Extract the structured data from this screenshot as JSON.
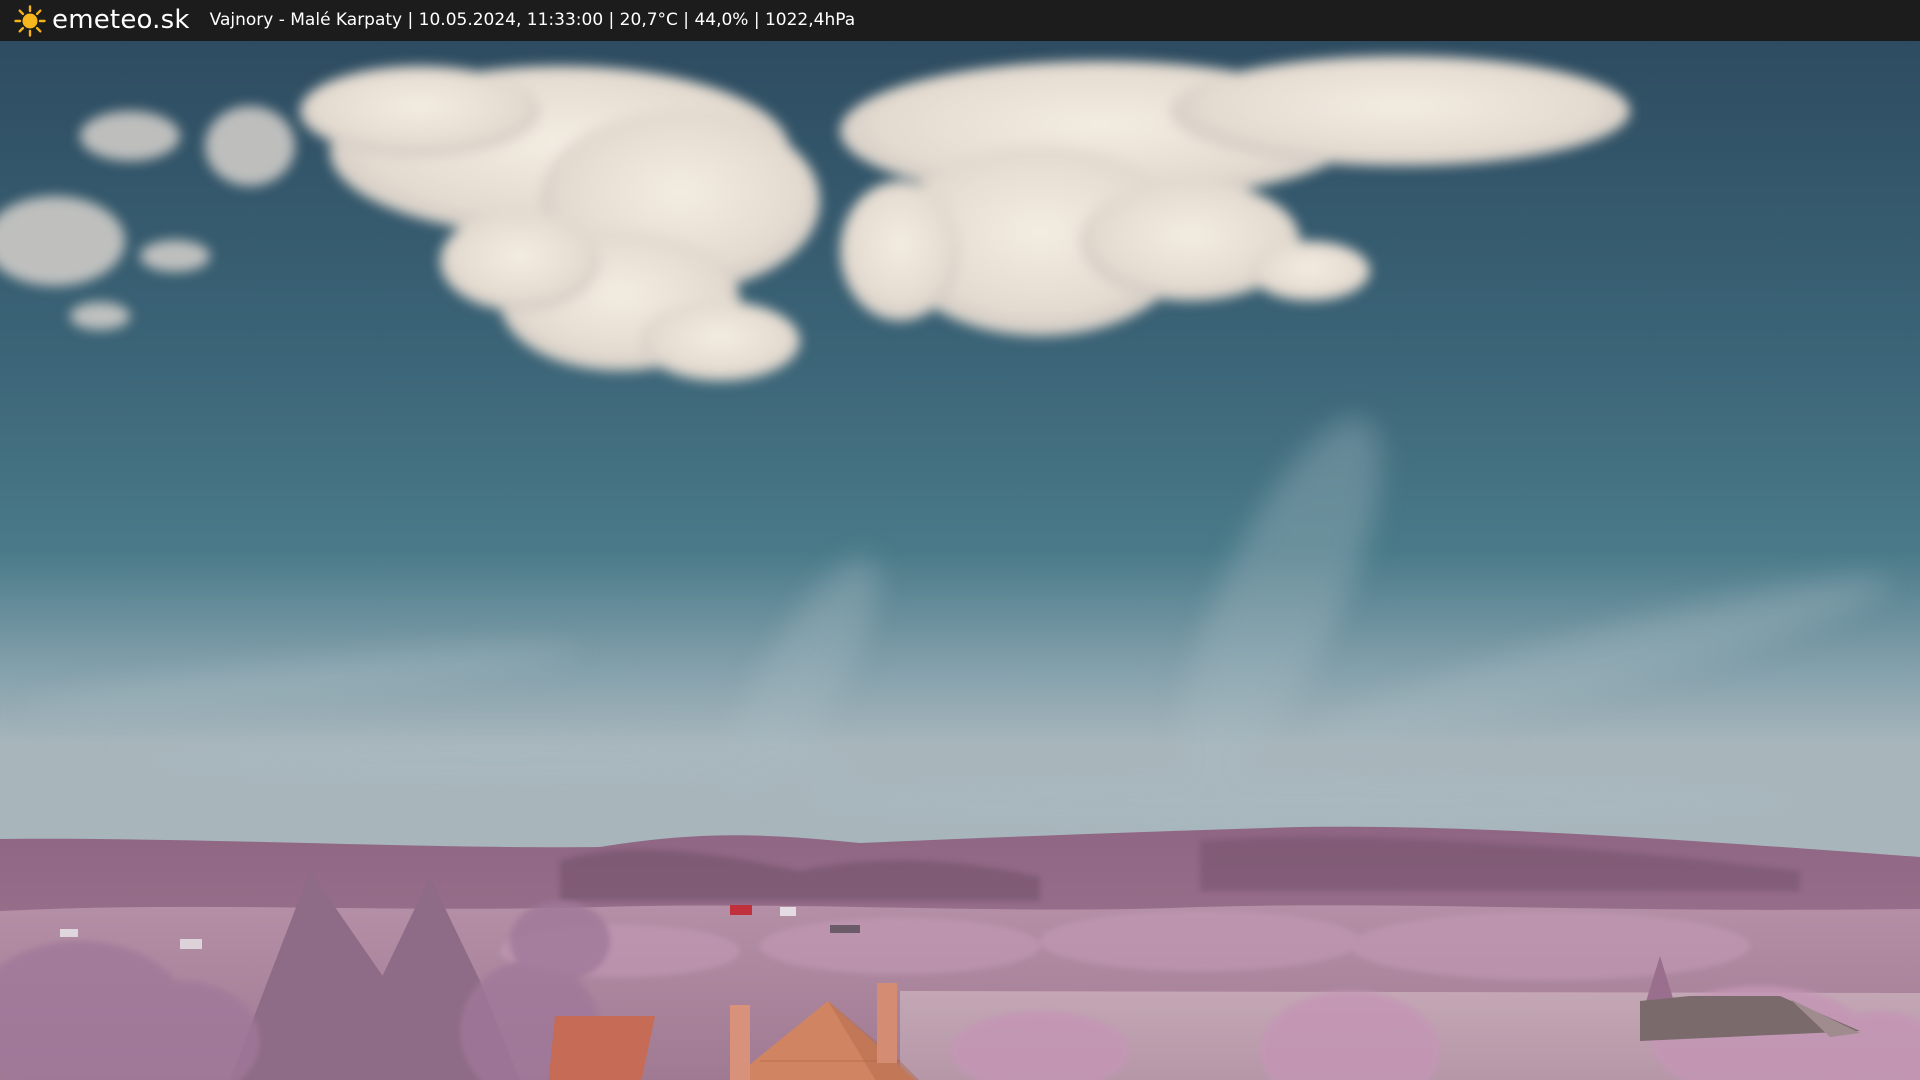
{
  "header": {
    "brand": "emeteo.sk",
    "brand_icon": "sun-icon",
    "info": "Vajnory - Malé Karpaty | 10.05.2024, 11:33:00 | 20,7°C | 44,0% | 1022,4hPa"
  },
  "scene": {
    "description_icon": "webcam-image",
    "colors": {
      "sky_top": "#2f4e62",
      "sky_mid": "#3f6a7c",
      "sky_horizon": "#9fb0ba",
      "cloud": "#efe6dc",
      "hills": "#8a6480",
      "trees": "#b98aa9",
      "roof": "#c46a52"
    }
  }
}
